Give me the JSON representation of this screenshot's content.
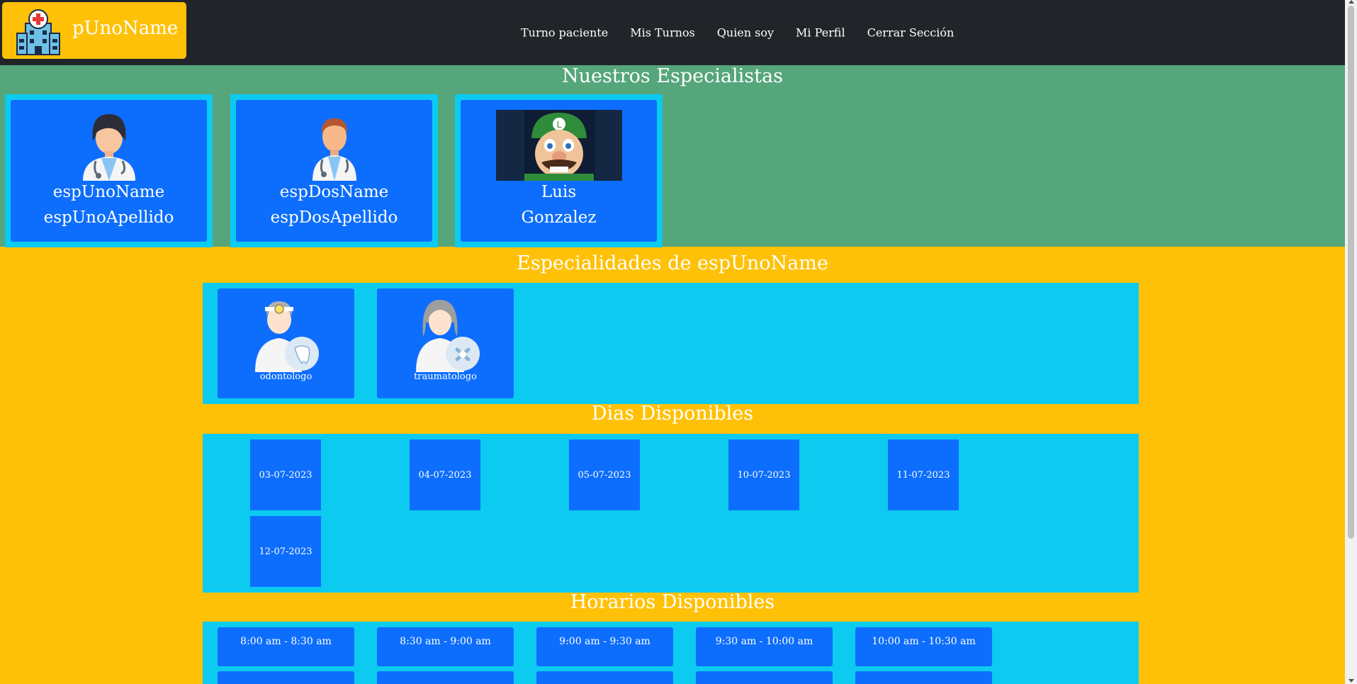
{
  "brand": {
    "name": "pUnoName",
    "logo_icon": "hospital-icon"
  },
  "nav": {
    "items": [
      {
        "label": "Turno paciente"
      },
      {
        "label": "Mis Turnos"
      },
      {
        "label": "Quien soy"
      },
      {
        "label": "Mi Perfil"
      },
      {
        "label": "Cerrar Sección"
      }
    ]
  },
  "specialists": {
    "title": "Nuestros Especialistas",
    "items": [
      {
        "first": "espUnoName",
        "last": "espUnoApellido",
        "avatar": "female-doctor-icon"
      },
      {
        "first": "espDosName",
        "last": "espDosApellido",
        "avatar": "male-doctor-icon"
      },
      {
        "first": "Luis",
        "last": "Gonzalez",
        "avatar": "photo"
      }
    ]
  },
  "specialties": {
    "title": "Especialidades de espUnoName",
    "items": [
      {
        "label": "odontologo",
        "icon": "dentist-icon"
      },
      {
        "label": "traumatologo",
        "icon": "traumatologist-icon"
      }
    ]
  },
  "days": {
    "title": "Dias Disponibles",
    "items": [
      "03-07-2023",
      "04-07-2023",
      "05-07-2023",
      "10-07-2023",
      "11-07-2023",
      "12-07-2023"
    ]
  },
  "hours": {
    "title": "Horarios Disponibles",
    "items": [
      "8:00 am - 8:30 am",
      "8:30 am - 9:00 am",
      "9:00 am - 9:30 am",
      "9:30 am - 10:00 am",
      "10:00 am - 10:30 am"
    ]
  },
  "colors": {
    "navbar": "#212529",
    "brand": "#ffc107",
    "green": "#56a67b",
    "cyan": "#0dcaf0",
    "blue": "#0d6efd"
  }
}
